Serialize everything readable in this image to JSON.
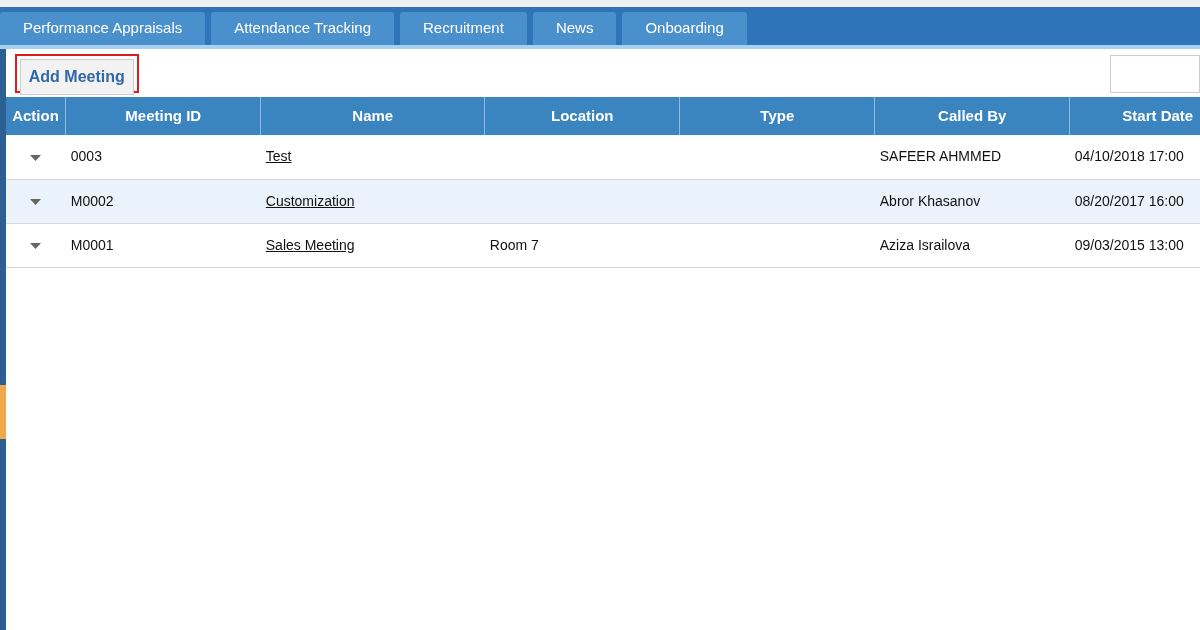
{
  "tabs": [
    {
      "label": "Performance Appraisals",
      "selected": false
    },
    {
      "label": "Attendance Tracking",
      "selected": false
    },
    {
      "label": "Recruitment",
      "selected": false
    },
    {
      "label": "News",
      "selected": false
    },
    {
      "label": "Onboarding",
      "selected": false
    }
  ],
  "toolbar": {
    "add_button": "Add Meeting",
    "add_button_highlighted": true
  },
  "table": {
    "columns": [
      "Action",
      "Meeting ID",
      "Name",
      "Location",
      "Type",
      "Called By",
      "Start Date"
    ],
    "rows": [
      {
        "selected": false,
        "meeting_id": "0003",
        "name": "Test",
        "location": "",
        "type": "",
        "called_by": "SAFEER AHMMED",
        "start_date": "04/10/2018 17:00"
      },
      {
        "selected": true,
        "meeting_id": "M0002",
        "name": "Customization",
        "location": "",
        "type": "",
        "called_by": "Abror Khasanov",
        "start_date": "08/20/2017 16:00"
      },
      {
        "selected": false,
        "meeting_id": "M0001",
        "name": "Sales Meeting",
        "location": "Room 7",
        "type": "",
        "called_by": "Aziza Israilova",
        "start_date": "09/03/2015 13:00"
      }
    ]
  }
}
